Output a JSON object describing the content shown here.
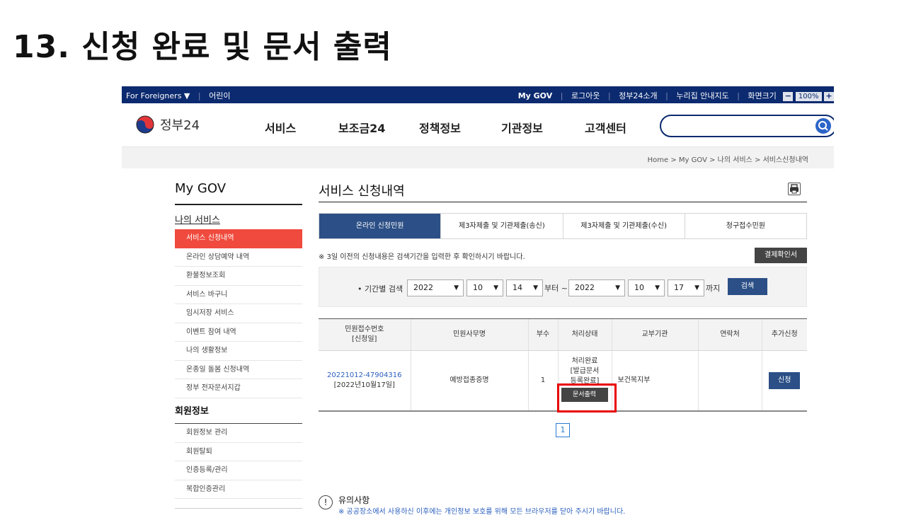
{
  "heading": "13. 신청 완료 및 문서 출력",
  "topbar": {
    "left": [
      "For Foreigners ▼",
      "어린이"
    ],
    "right": [
      "My GOV",
      "로그아웃",
      "정부24소개",
      "누리집 안내지도",
      "화면크기"
    ],
    "zoom_minus": "−",
    "zoom_value": "100%",
    "zoom_plus": "+"
  },
  "logo_text": "정부24",
  "nav": [
    "서비스",
    "보조금24",
    "정책정보",
    "기관정보",
    "고객센터"
  ],
  "breadcrumb": "Home  >  My GOV  >  나의 서비스  >  서비스신청내역",
  "sidebar": {
    "title": "My GOV",
    "section1": "나의 서비스",
    "items": [
      "서비스 신청내역",
      "온라인 상담예약 내역",
      "환불정보조회",
      "서비스 바구니",
      "임시저장 서비스",
      "이벤트 참여 내역",
      "나의 생활정보",
      "온종일 돌봄 신청내역",
      "정부 전자문서지갑"
    ],
    "section2": "회원정보",
    "items2": [
      "회원정보 관리",
      "회원탈퇴",
      "인증등록/관리",
      "복합인증관리"
    ]
  },
  "main": {
    "title": "서비스 신청내역",
    "tabs": [
      "온라인 신청민원",
      "제3자제출 및 기관제출(송신)",
      "제3자제출 및 기관제출(수신)",
      "청구접수민원"
    ],
    "notice": "※ 3일 이전의 신청내용은 검색기간을 입력한 후 확인하시기 바랍니다.",
    "receipt_button": "결제확인서"
  },
  "search": {
    "label": "• 기간별 검색",
    "from_year": "2022",
    "from_month": "10",
    "from_day": "14",
    "from_suffix": "부터 ~",
    "to_year": "2022",
    "to_month": "10",
    "to_day": "17",
    "to_suffix": "까지",
    "button": "검색"
  },
  "table": {
    "headers": [
      "민원접수번호\n[신청일]",
      "민원사무명",
      "부수",
      "처리상태",
      "교부기관",
      "연락처",
      "추가신청"
    ],
    "row": {
      "number": "20221012-47904316",
      "date": "[2022년10월17일]",
      "service": "예방접종증명",
      "copies": "1",
      "status": "처리완료\n[발급문서\n등록완료]",
      "print_button": "문서출력",
      "agency": "보건복지부",
      "contact": "",
      "apply_button": "신청"
    }
  },
  "pager": "1",
  "caution": {
    "title": "유의사항",
    "text": "※ 공공장소에서 사용하신 이후에는 개인정보 보호를 위해 모든 브라우저를 닫아 주시기 바랍니다."
  }
}
